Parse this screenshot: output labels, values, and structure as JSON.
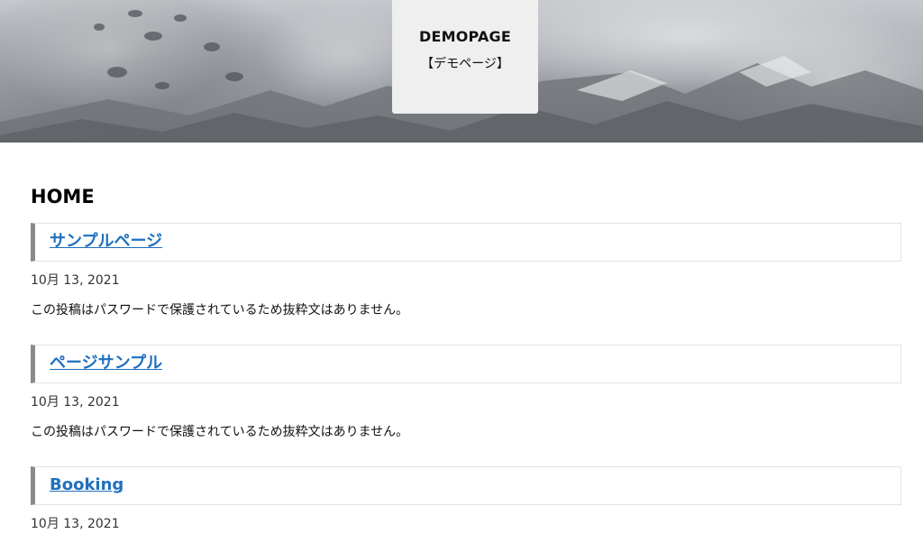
{
  "site": {
    "title": "DEMOPAGE",
    "tagline": "【デモページ】"
  },
  "page": {
    "heading": "HOME"
  },
  "posts": [
    {
      "title": "サンプルページ",
      "date": "10月 13, 2021",
      "excerpt": "この投稿はパスワードで保護されているため抜粋文はありません。"
    },
    {
      "title": "ページサンプル",
      "date": "10月 13, 2021",
      "excerpt": "この投稿はパスワードで保護されているため抜粋文はありません。"
    },
    {
      "title": "Booking",
      "date": "10月 13, 2021"
    }
  ],
  "colors": {
    "link": "#1f6fbf",
    "title_bar_accent": "#8a8a8a",
    "header_card": "#efefef"
  }
}
